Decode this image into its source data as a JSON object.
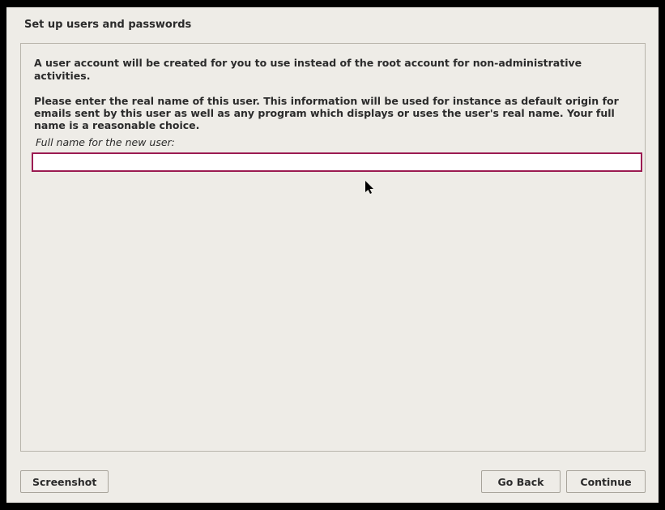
{
  "header": {
    "title": "Set up users and passwords"
  },
  "main": {
    "intro1": "A user account will be created for you to use instead of the root account for non-administrative activities.",
    "intro2": "Please enter the real name of this user. This information will be used for instance as default origin for emails sent by this user as well as any program which displays or uses the user's real name. Your full name is a reasonable choice.",
    "field_label": "Full name for the new user:",
    "field_value": ""
  },
  "buttons": {
    "screenshot": "Screenshot",
    "go_back": "Go Back",
    "continue": "Continue"
  }
}
